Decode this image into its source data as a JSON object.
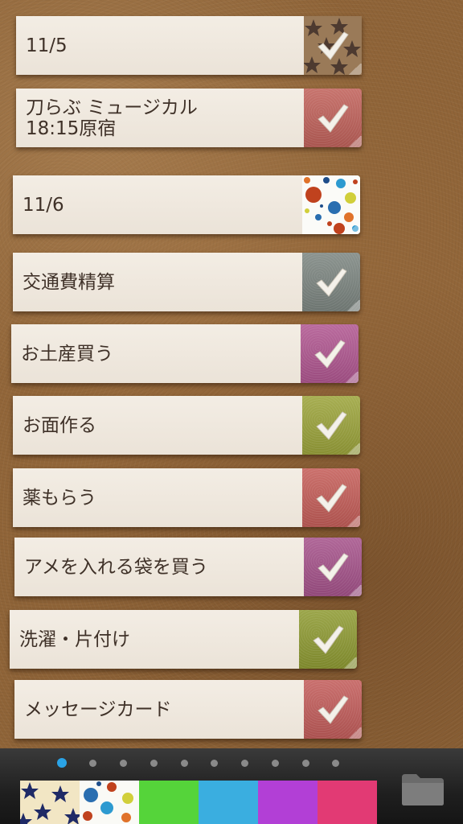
{
  "notes": [
    {
      "text": "11/5",
      "tab": "stars"
    },
    {
      "text": "刀らぶ ミュージカル\n18:15原宿",
      "tab_color": "#c0615a"
    },
    {
      "text": "11/6",
      "tab": "dots"
    },
    {
      "text": "交通費精算",
      "tab_color": "#7c8580"
    },
    {
      "text": "お土産買う",
      "tab_color": "#b05690"
    },
    {
      "text": "お面作る",
      "tab_color": "#9ba33a"
    },
    {
      "text": "薬もらう",
      "tab_color": "#c45d58"
    },
    {
      "text": "アメを入れる袋を買う",
      "tab_color": "#a5528a"
    },
    {
      "text": "洗濯・片付け",
      "tab_color": "#8e9a32"
    },
    {
      "text": "メッセージカード",
      "tab_color": "#c25c5a"
    }
  ],
  "pager": {
    "count": 10,
    "active": 0
  },
  "palette": [
    {
      "name": "stars",
      "color": "#f2e6c4"
    },
    {
      "name": "dots",
      "color": "#fafaf6"
    },
    {
      "name": "green",
      "color": "#55d43a"
    },
    {
      "name": "blue",
      "color": "#3aaee0"
    },
    {
      "name": "purple",
      "color": "#b23fd6"
    },
    {
      "name": "pink",
      "color": "#e23a74"
    }
  ],
  "icons": {
    "check": "checkmark-icon",
    "folder": "folder-icon"
  }
}
